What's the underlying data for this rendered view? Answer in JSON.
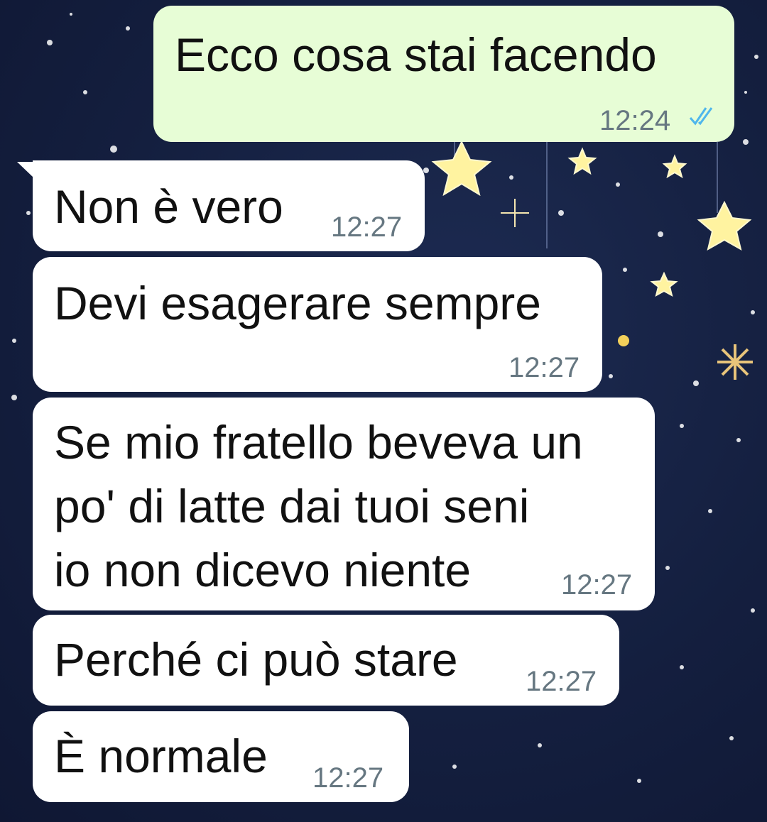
{
  "messages": [
    {
      "direction": "outgoing",
      "text": "Ecco cosa stai facendo",
      "time": "12:24",
      "status": "read"
    },
    {
      "direction": "incoming",
      "text": "Non è vero",
      "time": "12:27"
    },
    {
      "direction": "incoming",
      "text": "Devi esagerare sempre",
      "time": "12:27"
    },
    {
      "direction": "incoming",
      "text": "Se mio fratello beveva un\npo' di latte dai tuoi seni\nio non dicevo niente",
      "time": "12:27"
    },
    {
      "direction": "incoming",
      "text": "Perché ci può stare",
      "time": "12:27"
    },
    {
      "direction": "incoming",
      "text": "È normale",
      "time": "12:27"
    }
  ],
  "colors": {
    "outgoing_bubble": "#e7fdd6",
    "incoming_bubble": "#ffffff",
    "read_ticks": "#4fb6ec",
    "background": "#141f3f"
  },
  "wallpaper": "night-sky-stars"
}
